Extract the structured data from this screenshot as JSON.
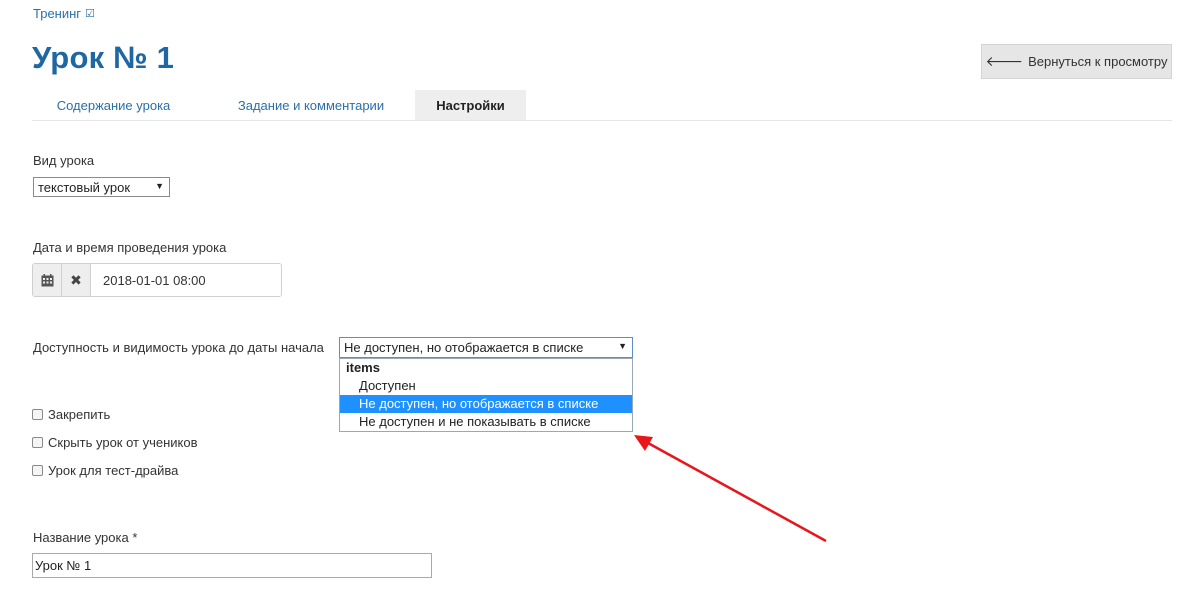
{
  "breadcrumb": {
    "label": "Тренинг",
    "icon": "checkbox-icon"
  },
  "page": {
    "title": "Урок № 1"
  },
  "header": {
    "back_button": "Вернуться к просмотру",
    "back_icon": "arrow-left-icon"
  },
  "tabs": [
    {
      "label": "Содержание урока",
      "active": false
    },
    {
      "label": "Задание и комментарии",
      "active": false
    },
    {
      "label": "Настройки",
      "active": true
    }
  ],
  "lesson_type": {
    "label": "Вид урока",
    "value": "текстовый урок"
  },
  "datetime": {
    "label": "Дата и время проведения урока",
    "value": "2018-01-01 08:00",
    "calendar_icon": "calendar-icon",
    "clear_icon": "close-icon"
  },
  "access": {
    "label": "Доступность и видимость урока до даты начала",
    "value": "Не доступен, но отображается в списке",
    "group": "items",
    "options": [
      "Доступен",
      "Не доступен, но отображается в списке",
      "Не доступен и не показывать в списке"
    ],
    "selected_index": 1
  },
  "checkboxes": [
    {
      "label": "Закрепить",
      "checked": false
    },
    {
      "label": "Скрыть урок от учеников",
      "checked": false
    },
    {
      "label": "Урок для тест-драйва",
      "checked": false
    }
  ],
  "lesson_name": {
    "label": "Название урока *",
    "value": "Урок № 1"
  },
  "colors": {
    "accent": "#1f67a3",
    "link": "#2a6fa8",
    "selection": "#1e90ff",
    "annotation": "#e8161b"
  }
}
